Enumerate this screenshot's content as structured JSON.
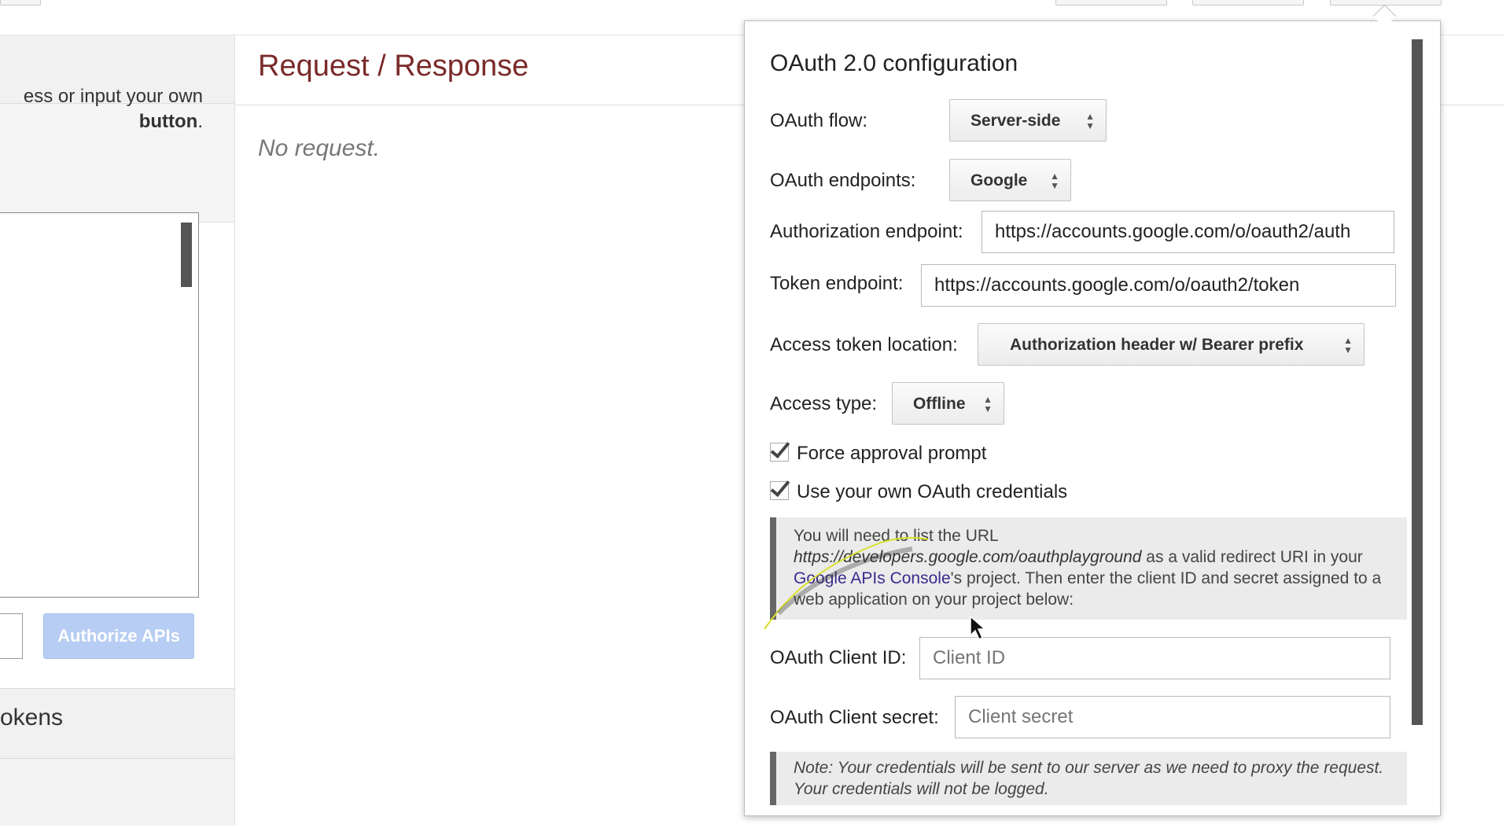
{
  "left": {
    "description_line1": "ess or input your own",
    "description_line2_bold": "button",
    "description_line2_rest": ".",
    "authorize_button": "Authorize APIs",
    "step3_title": "okens"
  },
  "main": {
    "title": "Request / Response",
    "empty_text": "No request."
  },
  "oauth": {
    "title": "OAuth 2.0 configuration",
    "flow_label": "OAuth flow:",
    "flow_value": "Server-side",
    "endpoints_label": "OAuth endpoints:",
    "endpoints_value": "Google",
    "auth_endpoint_label": "Authorization endpoint:",
    "auth_endpoint_value": "https://accounts.google.com/o/oauth2/auth",
    "token_endpoint_label": "Token endpoint:",
    "token_endpoint_value": "https://accounts.google.com/o/oauth2/token",
    "token_location_label": "Access token location:",
    "token_location_value": "Authorization header w/ Bearer prefix",
    "access_type_label": "Access type:",
    "access_type_value": "Offline",
    "force_approval_label": "Force approval prompt",
    "force_approval_checked": true,
    "own_credentials_label": "Use your own OAuth credentials",
    "own_credentials_checked": true,
    "redirect_note_1": "You will need to list the URL",
    "redirect_note_url": "https://developers.google.com/oauthplayground",
    "redirect_note_2": " as a valid redirect URI in your ",
    "redirect_note_link": "Google APIs Console",
    "redirect_note_3": "'s project. Then enter the client ID and secret assigned to a web application on your project below:",
    "client_id_label": "OAuth Client ID:",
    "client_id_placeholder": "Client ID",
    "client_secret_label": "OAuth Client secret:",
    "client_secret_placeholder": "Client secret",
    "credentials_note": "Note: Your credentials will be sent to our server as we need to proxy the request. Your credentials will not be logged."
  },
  "icons": {
    "select_arrows": "up-down-arrows-icon",
    "checkbox": "checkmark-icon",
    "cursor": "mouse-pointer-icon"
  },
  "colors": {
    "title_red": "#7a2a2a",
    "authorize_disabled": "#b7cdf3",
    "link_purple": "#3a2a8c"
  }
}
